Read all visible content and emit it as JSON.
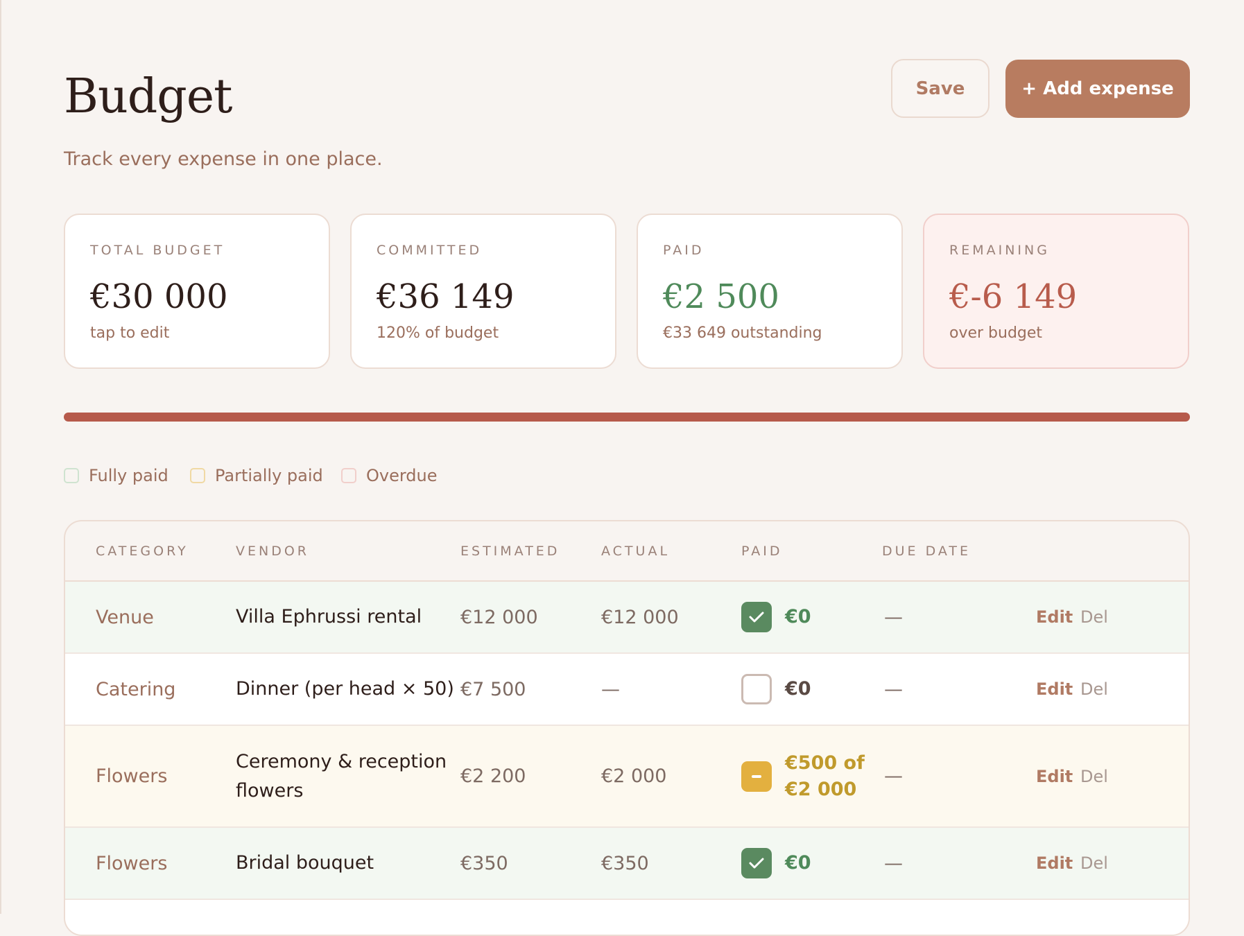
{
  "header": {
    "title": "Budget",
    "subtitle": "Track every expense in one place.",
    "save_label": "Save",
    "add_label": "+ Add expense"
  },
  "summary": [
    {
      "label": "TOTAL BUDGET",
      "value": "€30 000",
      "note": "tap to edit"
    },
    {
      "label": "COMMITTED",
      "value": "€36 149",
      "note": "120% of budget"
    },
    {
      "label": "PAID",
      "value": "€2 500",
      "note": "€33 649 outstanding"
    },
    {
      "label": "REMAINING",
      "value": "€-6 149",
      "note": "over budget"
    }
  ],
  "progress": {
    "fraction": 1.0,
    "color": "#b65a4b"
  },
  "legend": [
    {
      "label": "Fully paid",
      "color": "#cfe3d0"
    },
    {
      "label": "Partially paid",
      "color": "#f0d9a4"
    },
    {
      "label": "Overdue",
      "color": "#f1cfcb"
    }
  ],
  "table": {
    "headers": [
      "CATEGORY",
      "VENDOR",
      "ESTIMATED",
      "ACTUAL",
      "PAID",
      "DUE DATE"
    ],
    "rows": [
      {
        "category": "Venue",
        "vendor": "Villa Ephrussi rental",
        "estimated": "€12 000",
        "actual": "€12 000",
        "paid_state": "checked",
        "paid": "€0",
        "due": "—",
        "edit": "Edit",
        "del": "Del"
      },
      {
        "category": "Catering",
        "vendor": "Dinner (per head × 50)",
        "estimated": "€7 500",
        "actual": "—",
        "paid_state": "unchecked",
        "paid": "€0",
        "due": "—",
        "edit": "Edit",
        "del": "Del"
      },
      {
        "category": "Flowers",
        "vendor": "Ceremony & reception flowers",
        "estimated": "€2 200",
        "actual": "€2 000",
        "paid_state": "partial",
        "paid": "€500 of €2 000",
        "due": "—",
        "edit": "Edit",
        "del": "Del"
      },
      {
        "category": "Flowers",
        "vendor": "Bridal bouquet",
        "estimated": "€350",
        "actual": "€350",
        "paid_state": "checked",
        "paid": "€0",
        "due": "—",
        "edit": "Edit",
        "del": "Del"
      }
    ]
  }
}
